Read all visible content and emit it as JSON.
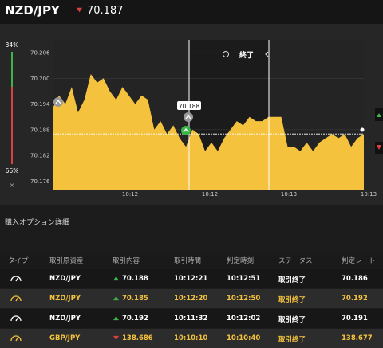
{
  "header": {
    "pair": "NZD/JPY",
    "rate": "70.187",
    "rate_direction": "down"
  },
  "colors": {
    "accent": "#f5c23d",
    "up": "#3bb54a",
    "down": "#d9423f",
    "background": "#1c1c1c"
  },
  "sentiment": {
    "high": "34%",
    "low": "66%",
    "close": "×"
  },
  "chart_data": {
    "type": "area",
    "y_ticks": [
      "70.206",
      "70.200",
      "70.194",
      "70.188",
      "70.182",
      "70.176"
    ],
    "x_ticks": [
      "10:12",
      "10:12",
      "10:13",
      "10:13"
    ],
    "ylim": [
      70.174,
      70.209
    ],
    "y": [
      70.193,
      70.196,
      70.194,
      70.198,
      70.192,
      70.195,
      70.201,
      70.199,
      70.2,
      70.197,
      70.195,
      70.198,
      70.196,
      70.194,
      70.196,
      70.195,
      70.188,
      70.19,
      70.187,
      70.189,
      70.186,
      70.184,
      70.188,
      70.187,
      70.183,
      70.185,
      70.183,
      70.186,
      70.188,
      70.19,
      70.189,
      70.191,
      70.19,
      70.19,
      70.191,
      70.191,
      70.191,
      70.184,
      70.184,
      70.183,
      70.185,
      70.183,
      70.185,
      70.186,
      70.187,
      70.186,
      70.187,
      70.184,
      70.186,
      70.187
    ],
    "current_rate_line": 70.187,
    "tooltip": "70.188",
    "expiry_label": "終了",
    "grid": true
  },
  "section_title": "購入オプション詳細",
  "table": {
    "headers": [
      "タイプ",
      "取引原資産",
      "取引内容",
      "取引時間",
      "判定時刻",
      "ステータス",
      "判定レート"
    ],
    "rows": [
      {
        "asset": "NZD/JPY",
        "direction": "up",
        "content": "70.188",
        "trade_time": "10:12:21",
        "judge_time": "10:12:51",
        "status": "取引終了",
        "rate": "70.186",
        "highlight": false
      },
      {
        "asset": "NZD/JPY",
        "direction": "up",
        "content": "70.185",
        "trade_time": "10:12:20",
        "judge_time": "10:12:50",
        "status": "取引終了",
        "rate": "70.192",
        "highlight": true
      },
      {
        "asset": "NZD/JPY",
        "direction": "up",
        "content": "70.192",
        "trade_time": "10:11:32",
        "judge_time": "10:12:02",
        "status": "取引終了",
        "rate": "70.191",
        "highlight": false
      },
      {
        "asset": "GBP/JPY",
        "direction": "down",
        "content": "138.686",
        "trade_time": "10:10:10",
        "judge_time": "10:10:40",
        "status": "取引終了",
        "rate": "138.677",
        "highlight": true
      }
    ]
  }
}
